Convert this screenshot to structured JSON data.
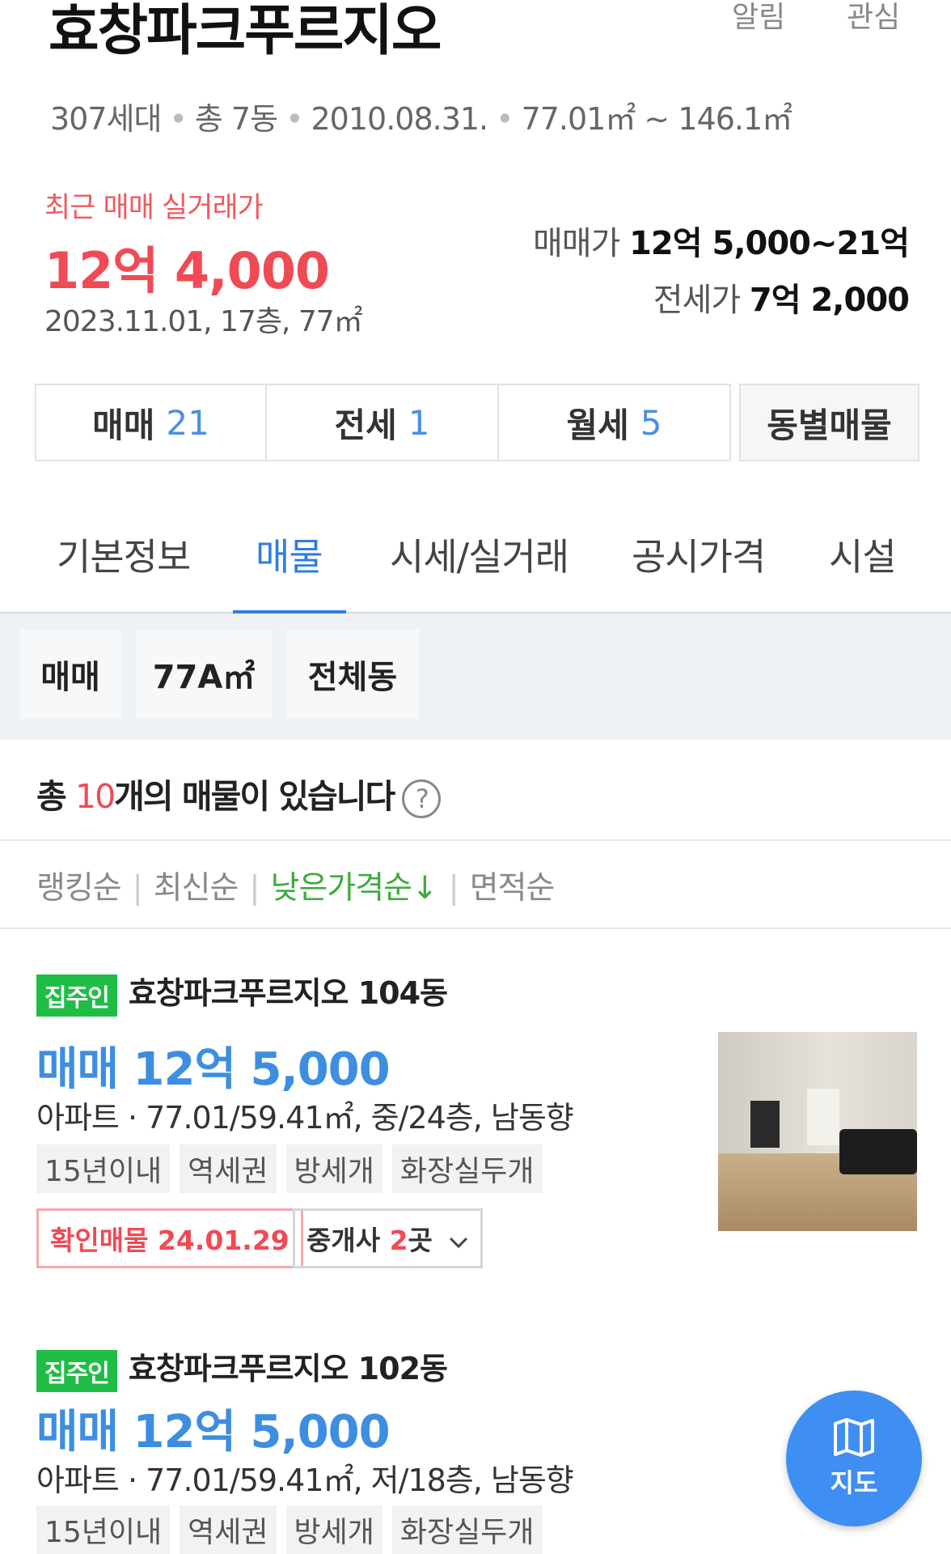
{
  "header": {
    "title": "효창파크푸르지오",
    "alert_label": "알림",
    "favorite_label": "관심",
    "households": "307세대",
    "buildings": "총 7동",
    "completion_date": "2010.08.31.",
    "area_range": "77.01㎡ ~ 146.1㎡"
  },
  "recent_trade": {
    "label": "최근 매매 실거래가",
    "price": "12억 4,000",
    "detail": "2023.11.01, 17층, 77㎡"
  },
  "price_summary": {
    "sale_label": "매매가",
    "sale_value": "12억 5,000~21억",
    "jeonse_label": "전세가",
    "jeonse_value": "7억 2,000"
  },
  "trade_types": [
    {
      "label": "매매",
      "count": "21"
    },
    {
      "label": "전세",
      "count": "1"
    },
    {
      "label": "월세",
      "count": "5"
    },
    {
      "label": "동별매물",
      "count": ""
    }
  ],
  "tabs": [
    "기본정보",
    "매물",
    "시세/실거래",
    "공시가격",
    "시설"
  ],
  "active_tab": "매물",
  "filters": [
    "매매",
    "77A㎡",
    "전체동"
  ],
  "listing_count": {
    "prefix": "총 ",
    "count": "10",
    "suffix": "개의 매물이 있습니다",
    "help_icon": "?"
  },
  "sort_options": [
    "랭킹순",
    "최신순",
    "낮은가격순↓",
    "면적순"
  ],
  "active_sort": "낮은가격순↓",
  "listings": [
    {
      "badge": "집주인",
      "title": "효창파크푸르지오 104동",
      "price": "매매 12억 5,000",
      "desc": "아파트 · 77.01/59.41㎡, 중/24층, 남동향",
      "tags": [
        "15년이내",
        "역세권",
        "방세개",
        "화장실두개"
      ],
      "verified": "확인매물 24.01.29",
      "agent_prefix": "중개사 ",
      "agent_count": "2",
      "agent_suffix": "곳"
    },
    {
      "badge": "집주인",
      "title": "효창파크푸르지오 102동",
      "price": "매매 12억 5,000",
      "desc": "아파트 · 77.01/59.41㎡, 저/18층, 남동향",
      "tags": [
        "15년이내",
        "역세권",
        "방세개",
        "화장실두개"
      ]
    }
  ],
  "map_button": {
    "label": "지도",
    "icon": "map-icon"
  },
  "colors": {
    "accent_blue": "#3d8ee0",
    "price_red": "#f04a55",
    "owner_green": "#1fbd45",
    "sort_green": "#3cab3c",
    "map_button": "#3f8ef2"
  }
}
